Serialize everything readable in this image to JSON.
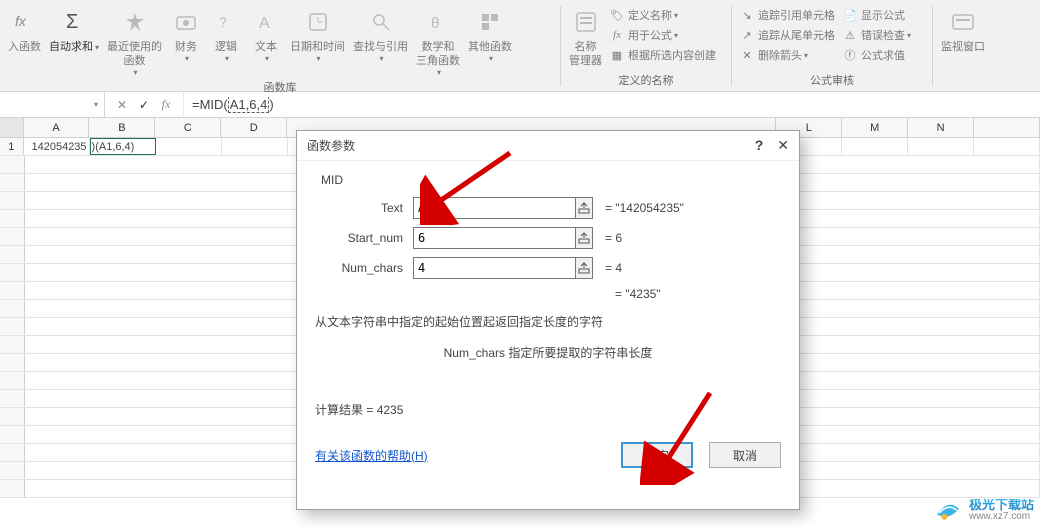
{
  "ribbon": {
    "fn_library_group": "函数库",
    "defined_names_group": "定义的名称",
    "formula_audit_group": "公式审核",
    "insert_function": "入函数",
    "autosum": "自动求和",
    "recently_used": "最近使用的\n函数",
    "financial": "财务",
    "logical": "逻辑",
    "text": "文本",
    "date_time": "日期和时间",
    "lookup_ref": "查找与引用",
    "math_trig": "数学和\n三角函数",
    "more_functions": "其他函数",
    "name_manager": "名称\n管理器",
    "define_name": "定义名称",
    "use_in_formula": "用于公式",
    "create_from_selection": "根据所选内容创建",
    "trace_precedents": "追踪引用单元格",
    "trace_dependents": "追踪从尾单元格",
    "remove_arrows": "删除箭头",
    "show_formulas": "显示公式",
    "error_checking": "错误检查",
    "evaluate_formula": "公式求值",
    "watch_window": "监视窗口"
  },
  "formula_bar": {
    "name_box": "",
    "formula_prefix": "=MID(",
    "formula_sel": "A1,6,4",
    "formula_suffix": ")"
  },
  "sheet": {
    "columns": [
      "A",
      "B",
      "C",
      "D",
      "",
      "",
      "",
      "",
      "",
      "",
      "",
      "L",
      "M",
      "N",
      ""
    ],
    "row1_header": "1",
    "a1": "142054235",
    "b1": ")(A1,6,4)"
  },
  "dialog": {
    "title": "函数参数",
    "func_name": "MID",
    "params": [
      {
        "label": "Text",
        "value": "A1",
        "eval": "= \"142054235\""
      },
      {
        "label": "Start_num",
        "value": "6",
        "eval": "= 6"
      },
      {
        "label": "Num_chars",
        "value": "4",
        "eval": "= 4"
      }
    ],
    "result_eval": "= \"4235\"",
    "description": "从文本字符串中指定的起始位置起返回指定长度的字符",
    "param_desc": "Num_chars  指定所要提取的字符串长度",
    "calc_label": "计算结果 = ",
    "calc_value": "4235",
    "help_link": "有关该函数的帮助(H)",
    "ok": "确定",
    "cancel": "取消"
  },
  "watermark": {
    "name": "极光下载站",
    "url": "www.xz7.com"
  }
}
